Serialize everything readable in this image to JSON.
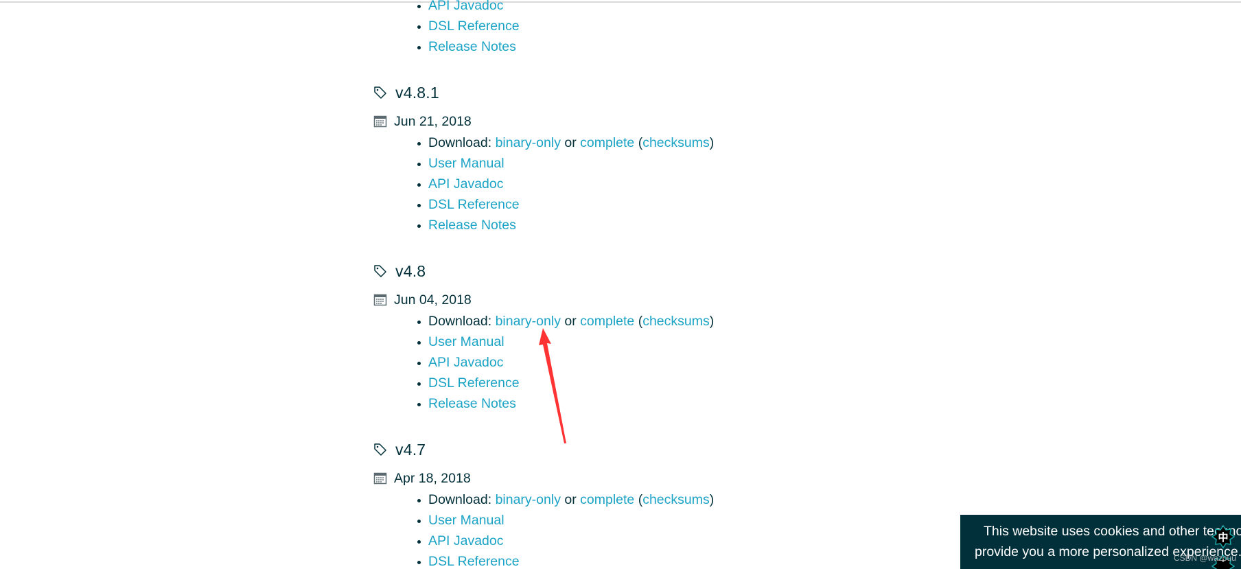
{
  "colors": {
    "text": "#02303a",
    "link": "#1ba3c6",
    "annotation_arrow": "#ff3333",
    "cookie_banner_bg": "#02303a"
  },
  "previous_release_tail": {
    "links": [
      {
        "label": "API Javadoc"
      },
      {
        "label": "DSL Reference"
      },
      {
        "label": "Release Notes"
      }
    ]
  },
  "releases": [
    {
      "version": "v4.8.1",
      "date": "Jun 21, 2018",
      "download_prefix": "Download:",
      "binary_label": "binary-only",
      "or_label": "or",
      "complete_label": "complete",
      "open_paren": "(",
      "checksums_label": "checksums",
      "close_paren": ")",
      "links": [
        {
          "label": "User Manual"
        },
        {
          "label": "API Javadoc"
        },
        {
          "label": "DSL Reference"
        },
        {
          "label": "Release Notes"
        }
      ]
    },
    {
      "version": "v4.8",
      "date": "Jun 04, 2018",
      "download_prefix": "Download:",
      "binary_label": "binary-only",
      "or_label": "or",
      "complete_label": "complete",
      "open_paren": "(",
      "checksums_label": "checksums",
      "close_paren": ")",
      "links": [
        {
          "label": "User Manual"
        },
        {
          "label": "API Javadoc"
        },
        {
          "label": "DSL Reference"
        },
        {
          "label": "Release Notes"
        }
      ]
    },
    {
      "version": "v4.7",
      "date": "Apr 18, 2018",
      "download_prefix": "Download:",
      "binary_label": "binary-only",
      "or_label": "or",
      "complete_label": "complete",
      "open_paren": "(",
      "checksums_label": "checksums",
      "close_paren": ")",
      "links": [
        {
          "label": "User Manual"
        },
        {
          "label": "API Javadoc"
        },
        {
          "label": "DSL Reference"
        }
      ]
    }
  ],
  "icons": {
    "version": "tag-icon",
    "date": "calendar-icon",
    "ime": "ime-indicator-icon"
  },
  "cookie_banner": {
    "line1": "This website uses cookies and other technologies to",
    "line2": "provide you a more personalized experience."
  },
  "ime_indicator": {
    "glyph": "中"
  },
  "watermark": "CSDN @wazouu"
}
